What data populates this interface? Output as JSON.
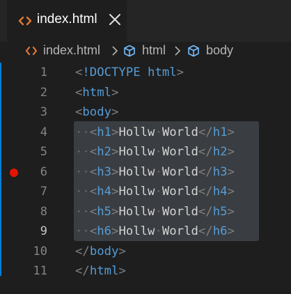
{
  "tab": {
    "label": "index.html",
    "file_icon": "html-file-icon",
    "close_icon": "close-icon"
  },
  "breadcrumb": {
    "items": [
      {
        "label": "index.html",
        "icon": "html-file-icon"
      },
      {
        "label": "html",
        "icon": "symbol-element-icon"
      },
      {
        "label": "body",
        "icon": "symbol-element-icon"
      }
    ]
  },
  "editor": {
    "lines": [
      {
        "number": "1",
        "indent": "",
        "parts": {
          "open": "<",
          "doctype": "!DOCTYPE",
          "sp": " ",
          "name": "html",
          "close": ">"
        }
      },
      {
        "number": "2",
        "indent": "",
        "parts": {
          "open": "<",
          "name": "html",
          "close": ">"
        }
      },
      {
        "number": "3",
        "indent": "",
        "parts": {
          "open": "<",
          "name": "body",
          "close": ">"
        }
      },
      {
        "number": "4",
        "indent": "··",
        "parts": {
          "open": "<",
          "name": "h1",
          "close": ">",
          "text1": "Hollw",
          "dot": "·",
          "text2": "World",
          "eopen": "</",
          "ename": "h1",
          "eclose": ">"
        }
      },
      {
        "number": "5",
        "indent": "··",
        "parts": {
          "open": "<",
          "name": "h2",
          "close": ">",
          "text1": "Hollw",
          "dot": "·",
          "text2": "World",
          "eopen": "</",
          "ename": "h2",
          "eclose": ">"
        }
      },
      {
        "number": "6",
        "indent": "··",
        "parts": {
          "open": "<",
          "name": "h3",
          "close": ">",
          "text1": "Hollw",
          "dot": "·",
          "text2": "World",
          "eopen": "</",
          "ename": "h3",
          "eclose": ">"
        }
      },
      {
        "number": "7",
        "indent": "··",
        "parts": {
          "open": "<",
          "name": "h4",
          "close": ">",
          "text1": "Hollw",
          "dot": "·",
          "text2": "World",
          "eopen": "</",
          "ename": "h4",
          "eclose": ">"
        }
      },
      {
        "number": "8",
        "indent": "··",
        "parts": {
          "open": "<",
          "name": "h5",
          "close": ">",
          "text1": "Hollw",
          "dot": "·",
          "text2": "World",
          "eopen": "</",
          "ename": "h5",
          "eclose": ">"
        }
      },
      {
        "number": "9",
        "indent": "··",
        "parts": {
          "open": "<",
          "name": "h6",
          "close": ">",
          "text1": "Hollw",
          "dot": "·",
          "text2": "World",
          "eopen": "</",
          "ename": "h6",
          "eclose": ">"
        }
      },
      {
        "number": "10",
        "indent": "",
        "parts": {
          "open": "</",
          "name": "body",
          "close": ">"
        }
      },
      {
        "number": "11",
        "indent": "",
        "parts": {
          "open": "</",
          "name": "html",
          "close": ">"
        }
      }
    ],
    "active_line": "9",
    "breakpoint_line": "6",
    "colors": {
      "tag": "#569cd6",
      "punctuation": "#808080",
      "text": "#d4d4d4",
      "whitespace": "#6b6b6b",
      "selection": "#3a3d41",
      "breakpoint": "#e51400",
      "html_icon": "#e37933"
    }
  }
}
